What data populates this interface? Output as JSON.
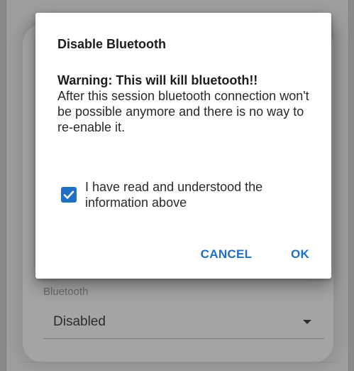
{
  "background": {
    "field_label": "Bluetooth",
    "select_value": "Disabled"
  },
  "dialog": {
    "title": "Disable Bluetooth",
    "warning": "Warning: This will kill bluetooth!!",
    "message": "After this session bluetooth connection won't be possible anymore and there is no way to re-enable it.",
    "checkbox": {
      "label": "I have read and understood the information above",
      "checked": true
    },
    "buttons": {
      "cancel": "CANCEL",
      "ok": "OK"
    }
  },
  "colors": {
    "accent": "#1f6fc5",
    "scrim": "#8a8a8a",
    "dialog_bg": "#ffffff"
  },
  "icons": {
    "checkbox": "check-icon",
    "select_caret": "caret-down-icon"
  }
}
